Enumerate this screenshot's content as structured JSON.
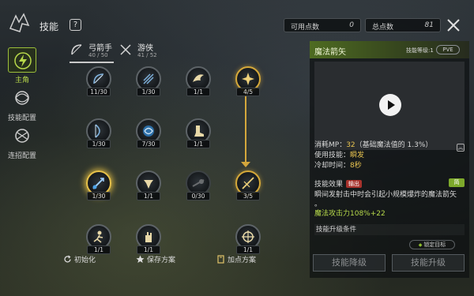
{
  "header": {
    "title": "技能",
    "help_icon": "?",
    "available_points_label": "可用点数",
    "available_points_value": "0",
    "total_points_label": "总点数",
    "total_points_value": "81"
  },
  "sidebar": {
    "items": [
      {
        "label": "主角",
        "icon": "bolt-icon",
        "active": true
      },
      {
        "label": "技能配置",
        "icon": "spiral-icon",
        "active": false
      },
      {
        "label": "连招配置",
        "icon": "combo-icon",
        "active": false
      }
    ]
  },
  "classes": [
    {
      "name": "弓箭手",
      "points": "40 / 50",
      "icon": "bow-icon"
    },
    {
      "name": "游侠",
      "points": "41 / 52",
      "icon": "crossed-arrows-icon"
    }
  ],
  "skills": [
    {
      "level": "11/30",
      "icon": "bow-arrow-icon",
      "style": "normal"
    },
    {
      "level": "1/30",
      "icon": "multi-arrow-icon",
      "style": "normal"
    },
    {
      "level": "1/1",
      "icon": "wing-icon",
      "style": "normal"
    },
    {
      "level": "4/5",
      "icon": "burst-icon",
      "style": "gold"
    },
    {
      "level": "1/30",
      "icon": "feather-bow-icon",
      "style": "normal"
    },
    {
      "level": "7/30",
      "icon": "whirl-icon",
      "style": "normal"
    },
    {
      "level": "1/1",
      "icon": "boots-icon",
      "style": "normal"
    },
    {
      "level": "1/30",
      "icon": "magic-arrow-icon",
      "style": "selected"
    },
    {
      "level": "1/1",
      "icon": "trap-icon",
      "style": "normal"
    },
    {
      "level": "0/30",
      "icon": "shot-icon",
      "style": "dim"
    },
    {
      "level": "3/5",
      "icon": "slash-arrow-icon",
      "style": "gold"
    },
    {
      "level": "1/1",
      "icon": "dash-icon",
      "style": "normal"
    },
    {
      "level": "1/1",
      "icon": "hand-icon",
      "style": "normal"
    },
    {
      "level": "1/1",
      "icon": "aim-icon",
      "style": "normal"
    }
  ],
  "bottom": {
    "reset_label": "初始化",
    "save_label": "保存方案",
    "plan_label": "加点方案"
  },
  "detail": {
    "skill_name": "魔法箭矢",
    "skill_level": "技能等级:1",
    "mode": "PVE",
    "mp_label": "消耗MP：",
    "mp_value": "32",
    "mp_note": "（基础魔法值的 1.3%）",
    "use_label": "使用技能：",
    "use_value": "瞬发",
    "cd_label": "冷却时间：",
    "cd_value": "8秒",
    "effect_label": "技能效果",
    "effect_tag": "输出",
    "effect_badge": "简",
    "effect_desc": "瞬间发射击中时会引起小规模爆炸的魔法箭矢",
    "effect_desc2": "。",
    "attack": "魔法攻击力108%+22",
    "upgrade_condition": "技能升级条件",
    "lock_target": "锁定目标",
    "downgrade_button": "技能降级",
    "upgrade_button": "技能升级"
  },
  "colors": {
    "accent_green": "#9cbf3a",
    "gold": "#d4a73c",
    "highlight_yellow": "#e8c450"
  }
}
